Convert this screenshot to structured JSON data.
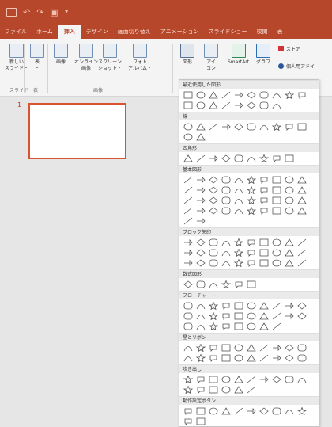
{
  "tabs": [
    "ファイル",
    "ホーム",
    "挿入",
    "デザイン",
    "画面切り替え",
    "アニメーション",
    "スライドショー",
    "校閲",
    "表"
  ],
  "active_tab_index": 2,
  "ribbon": {
    "new_slide": "新しい\nスライド・",
    "table": "表\n・",
    "image": "画像",
    "online_image": "オンライン\n画像",
    "screenshot": "スクリーン\nショット・",
    "photo_album": "フォト\nアルバム・",
    "shapes": "図形",
    "icons": "アイ\nコン",
    "smartart": "SmartArt",
    "chart": "グラフ",
    "store": "ストア",
    "personal_addins": "個人用アドイ",
    "group_slide": "スライド",
    "group_table": "表",
    "group_image": "画像"
  },
  "slides": [
    {
      "number": "1"
    }
  ],
  "dropdown": {
    "sections": [
      {
        "title": "最近使用した図形",
        "count": 18
      },
      {
        "title": "線",
        "count": 12
      },
      {
        "title": "四角形",
        "count": 9
      },
      {
        "title": "基本図形",
        "count": 42
      },
      {
        "title": "ブロック矢印",
        "count": 30
      },
      {
        "title": "数式図形",
        "count": 6
      },
      {
        "title": "フローチャート",
        "count": 28
      },
      {
        "title": "星とリボン",
        "count": 20
      },
      {
        "title": "吹き出し",
        "count": 16
      },
      {
        "title": "動作設定ボタン",
        "count": 12
      }
    ]
  },
  "colors": {
    "accent": "#b7472a",
    "thumb_border": "#d9532e"
  }
}
